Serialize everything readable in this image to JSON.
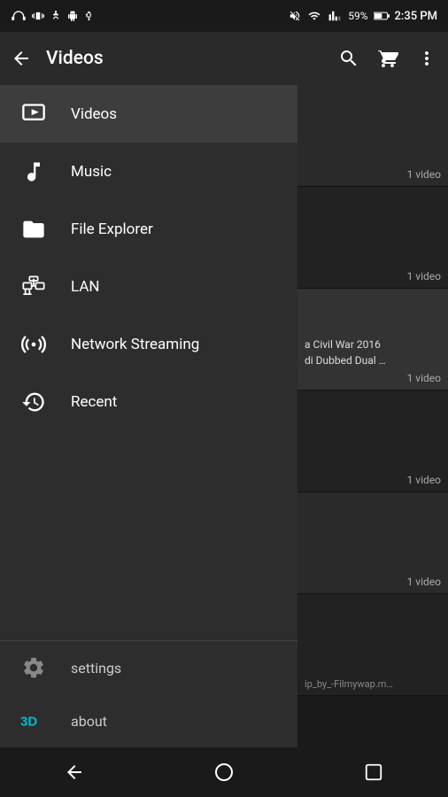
{
  "statusBar": {
    "time": "2:35 PM",
    "battery": "59%",
    "icons": [
      "headphones",
      "vibrate",
      "accessibility",
      "android",
      "usb"
    ]
  },
  "toolbar": {
    "back_label": "←",
    "title": "Videos",
    "search_label": "Search",
    "cart_label": "Cart",
    "more_label": "More"
  },
  "menu": {
    "items": [
      {
        "id": "videos",
        "label": "Videos",
        "active": true
      },
      {
        "id": "music",
        "label": "Music",
        "active": false
      },
      {
        "id": "file-explorer",
        "label": "File Explorer",
        "active": false
      },
      {
        "id": "lan",
        "label": "LAN",
        "active": false
      },
      {
        "id": "network-streaming",
        "label": "Network Streaming",
        "active": false
      },
      {
        "id": "recent",
        "label": "Recent",
        "active": false
      }
    ],
    "bottom": [
      {
        "id": "settings",
        "label": "settings"
      },
      {
        "id": "about",
        "label": "about"
      }
    ]
  },
  "videoList": {
    "items": [
      {
        "count": "1 video",
        "thumb": ""
      },
      {
        "count": "1 video",
        "thumb": ""
      },
      {
        "count": "1 video",
        "text": "a Civil War 2016 di Dubbed Dual …"
      },
      {
        "count": "1 video",
        "thumb": ""
      },
      {
        "count": "1 video",
        "thumb": ""
      },
      {
        "count": "",
        "text": "ip_by_-Filmywap.m…"
      }
    ]
  },
  "navBar": {
    "back_label": "◁",
    "home_label": "○",
    "square_label": "□"
  }
}
